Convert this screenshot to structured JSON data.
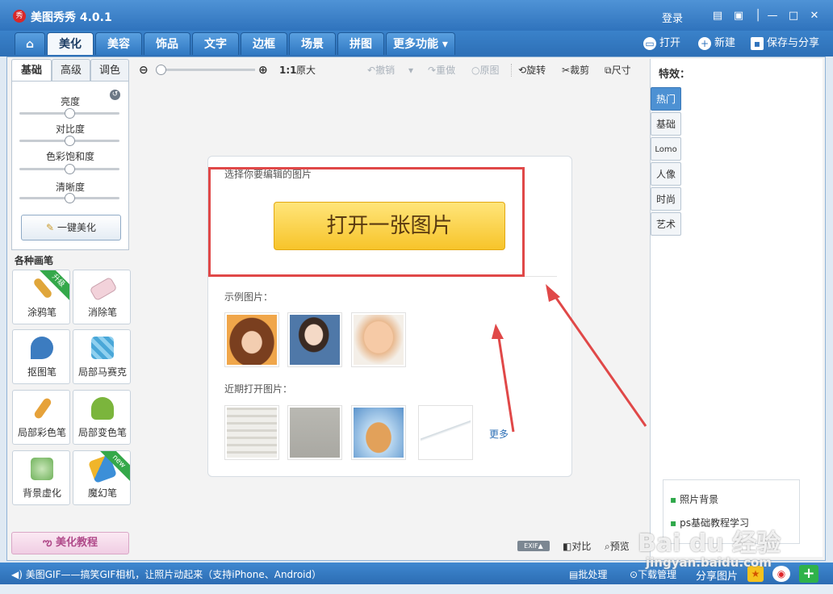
{
  "app": {
    "title": "美图秀秀 4.0.1",
    "logo_text": "秀",
    "login": "登录"
  },
  "window_controls": [
    "chat-icon",
    "skin-icon",
    "menu-icon",
    "minimize-icon",
    "maximize-icon",
    "close-icon"
  ],
  "nav": {
    "home_icon": "home-icon",
    "tabs": [
      "美化",
      "美容",
      "饰品",
      "文字",
      "边框",
      "场景",
      "拼图",
      "更多功能"
    ],
    "active_tab": "美化",
    "open_label": "打开",
    "new_label": "新建",
    "save_label": "保存与分享"
  },
  "left_panel": {
    "sub_tabs": [
      "基础",
      "高级",
      "调色"
    ],
    "adjustments": [
      "亮度",
      "对比度",
      "色彩饱和度",
      "清晰度"
    ],
    "one_key": "一键美化",
    "brush_section_title": "各种画笔",
    "brushes": [
      {
        "label": "涂鸦笔",
        "badge": "升级",
        "color": "#e0a63a"
      },
      {
        "label": "消除笔",
        "badge": "",
        "color": "#e8b3c0"
      },
      {
        "label": "抠图笔",
        "badge": "",
        "color": "#3c7cc0"
      },
      {
        "label": "局部马赛克",
        "badge": "",
        "color": "#4aa7d8"
      },
      {
        "label": "局部彩色笔",
        "badge": "",
        "color": "#e6a23a"
      },
      {
        "label": "局部变色笔",
        "badge": "",
        "color": "#7bb53c"
      },
      {
        "label": "背景虚化",
        "badge": "",
        "color": "#6fb15a"
      },
      {
        "label": "魔幻笔",
        "badge": "new",
        "color": "#f0b52a"
      }
    ],
    "tutorial": "美化教程"
  },
  "toolbar": {
    "ratio": "1:1",
    "original_size": "原大",
    "undo": "撤销",
    "redo": "重做",
    "original": "原图",
    "rotate": "旋转",
    "crop": "裁剪",
    "size": "尺寸"
  },
  "center": {
    "select_label": "选择你要编辑的图片",
    "open_button": "打开一张图片",
    "sample_label": "示例图片：",
    "recent_label": "近期打开图片：",
    "more": "更多"
  },
  "right_panel": {
    "title": "特效：",
    "tabs": [
      "热门",
      "基础",
      "Lomo",
      "人像",
      "时尚",
      "艺术"
    ],
    "active_tab": "热门",
    "tips": [
      "照片背景",
      "ps基础教程学习"
    ]
  },
  "bottom_controls": {
    "exif": "EXIF▲",
    "compare": "对比",
    "preview": "预览"
  },
  "statusbar": {
    "message": "美图GIF——搞笑GIF相机，让照片动起来（支持iPhone、Android）",
    "batch": "批处理",
    "download": "下载管理",
    "share": "分享图片"
  },
  "watermark": {
    "logo": "Bai du 经验",
    "url": "jingyan.baidu.com"
  },
  "colors": {
    "accent_blue": "#2f73bd",
    "annotation_red": "#e04848",
    "button_yellow": "#f7c42a"
  }
}
